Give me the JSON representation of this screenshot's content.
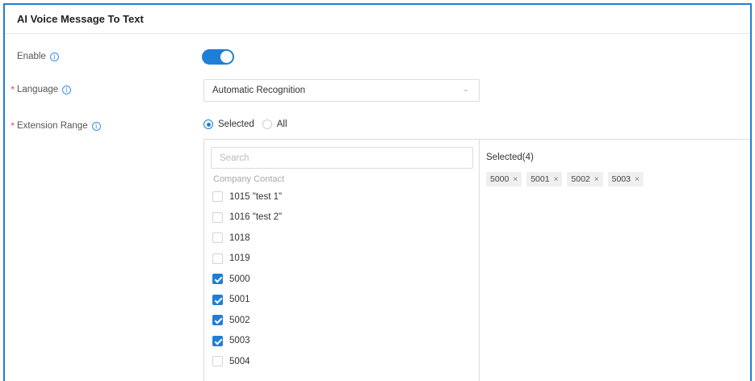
{
  "title": "AI Voice Message To Text",
  "enable": {
    "label": "Enable",
    "on": true
  },
  "language": {
    "label": "Language",
    "required": true,
    "value": "Automatic Recognition"
  },
  "extension_range": {
    "label": "Extension Range",
    "required": true,
    "options": [
      "Selected",
      "All"
    ],
    "selected_option": "Selected"
  },
  "transfer": {
    "search_placeholder": "Search",
    "group_label": "Company Contact",
    "items": [
      {
        "label": "1015 \"test 1\"",
        "checked": false
      },
      {
        "label": "1016 \"test 2\"",
        "checked": false
      },
      {
        "label": "1018",
        "checked": false
      },
      {
        "label": "1019",
        "checked": false
      },
      {
        "label": "5000",
        "checked": true
      },
      {
        "label": "5001",
        "checked": true
      },
      {
        "label": "5002",
        "checked": true
      },
      {
        "label": "5003",
        "checked": true
      },
      {
        "label": "5004",
        "checked": false
      }
    ],
    "selected_title": "Selected(4)",
    "selected_tags": [
      "5000",
      "5001",
      "5002",
      "5003"
    ]
  },
  "colors": {
    "accent": "#1e7fd6",
    "required": "#e04848"
  },
  "icons": {
    "info": "info-circle-icon",
    "chevron": "chevron-down-icon",
    "tag_close": "close-icon"
  }
}
